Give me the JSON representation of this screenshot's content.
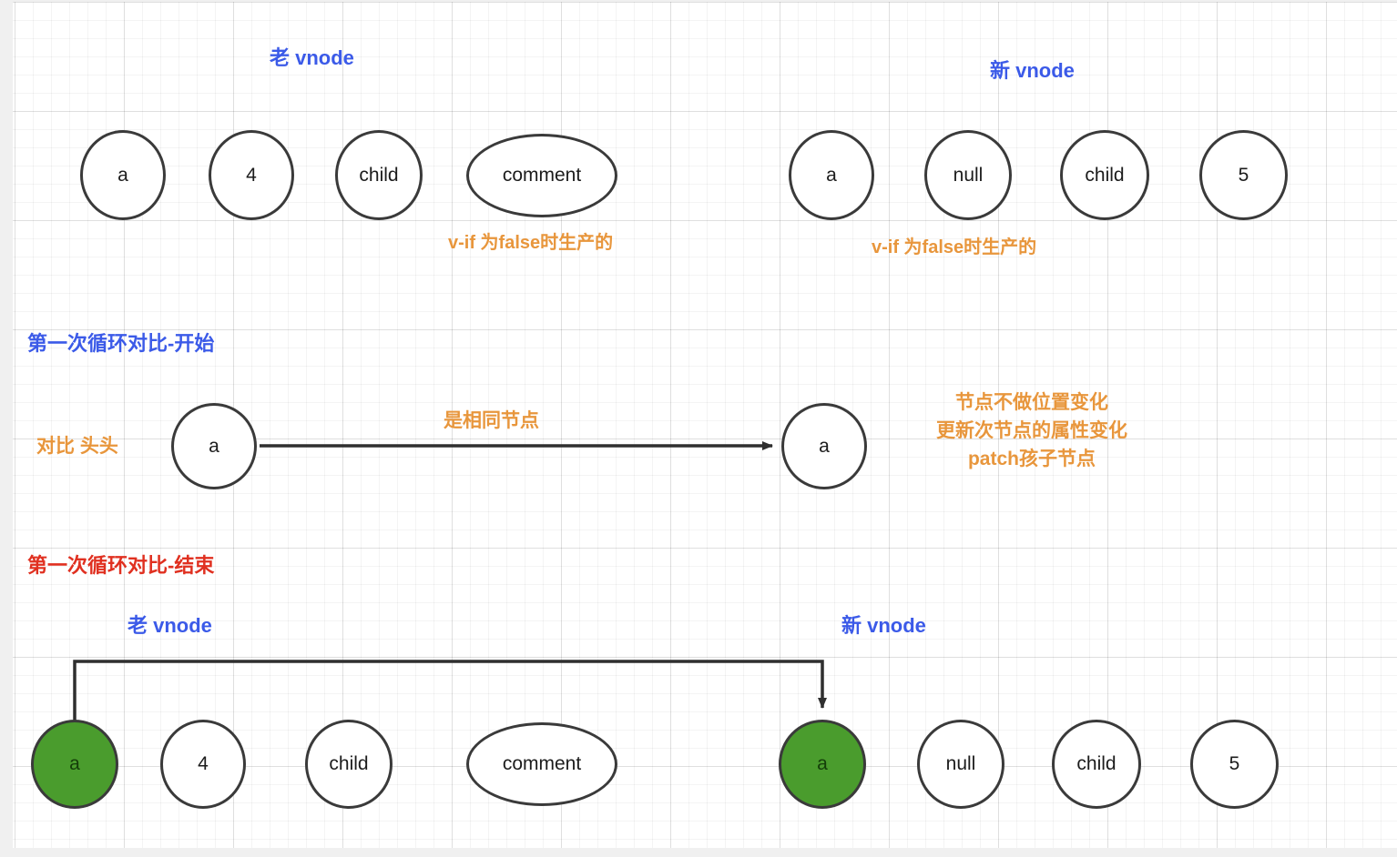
{
  "diagram": {
    "title_top_left": "老 vnode",
    "title_top_right": "新 vnode",
    "section_start_label": "第一次循环对比-开始",
    "section_end_label": "第一次循环对比-结束",
    "title_bottom_left": "老 vnode",
    "title_bottom_right": "新 vnode"
  },
  "top_row": {
    "old_nodes": [
      {
        "text": "a"
      },
      {
        "text": "4"
      },
      {
        "text": "child"
      },
      {
        "text": "comment"
      }
    ],
    "new_nodes": [
      {
        "text": "a"
      },
      {
        "text": "null"
      },
      {
        "text": "child"
      },
      {
        "text": "5"
      }
    ],
    "old_note": "v-if 为false时生产的",
    "new_note": "v-if 为false时生产的"
  },
  "compare_row": {
    "left_label": "对比 头头",
    "old_node": {
      "text": "a"
    },
    "new_node": {
      "text": "a"
    },
    "arrow_label": "是相同节点",
    "result_note_line1": "节点不做位置变化",
    "result_note_line2": "更新次节点的属性变化",
    "result_note_line3": "patch孩子节点"
  },
  "bottom_row": {
    "old_nodes": [
      {
        "text": "a",
        "highlighted": true
      },
      {
        "text": "4",
        "highlighted": false
      },
      {
        "text": "child",
        "highlighted": false
      },
      {
        "text": "comment",
        "highlighted": false
      }
    ],
    "new_nodes": [
      {
        "text": "a",
        "highlighted": true
      },
      {
        "text": "null",
        "highlighted": false
      },
      {
        "text": "child",
        "highlighted": false
      },
      {
        "text": "5",
        "highlighted": false
      }
    ]
  },
  "colors": {
    "blue": "#3b5ae8",
    "red": "#e03020",
    "orange": "#e8963c",
    "green": "#4a9c2d",
    "stroke": "#3a3a3a"
  }
}
